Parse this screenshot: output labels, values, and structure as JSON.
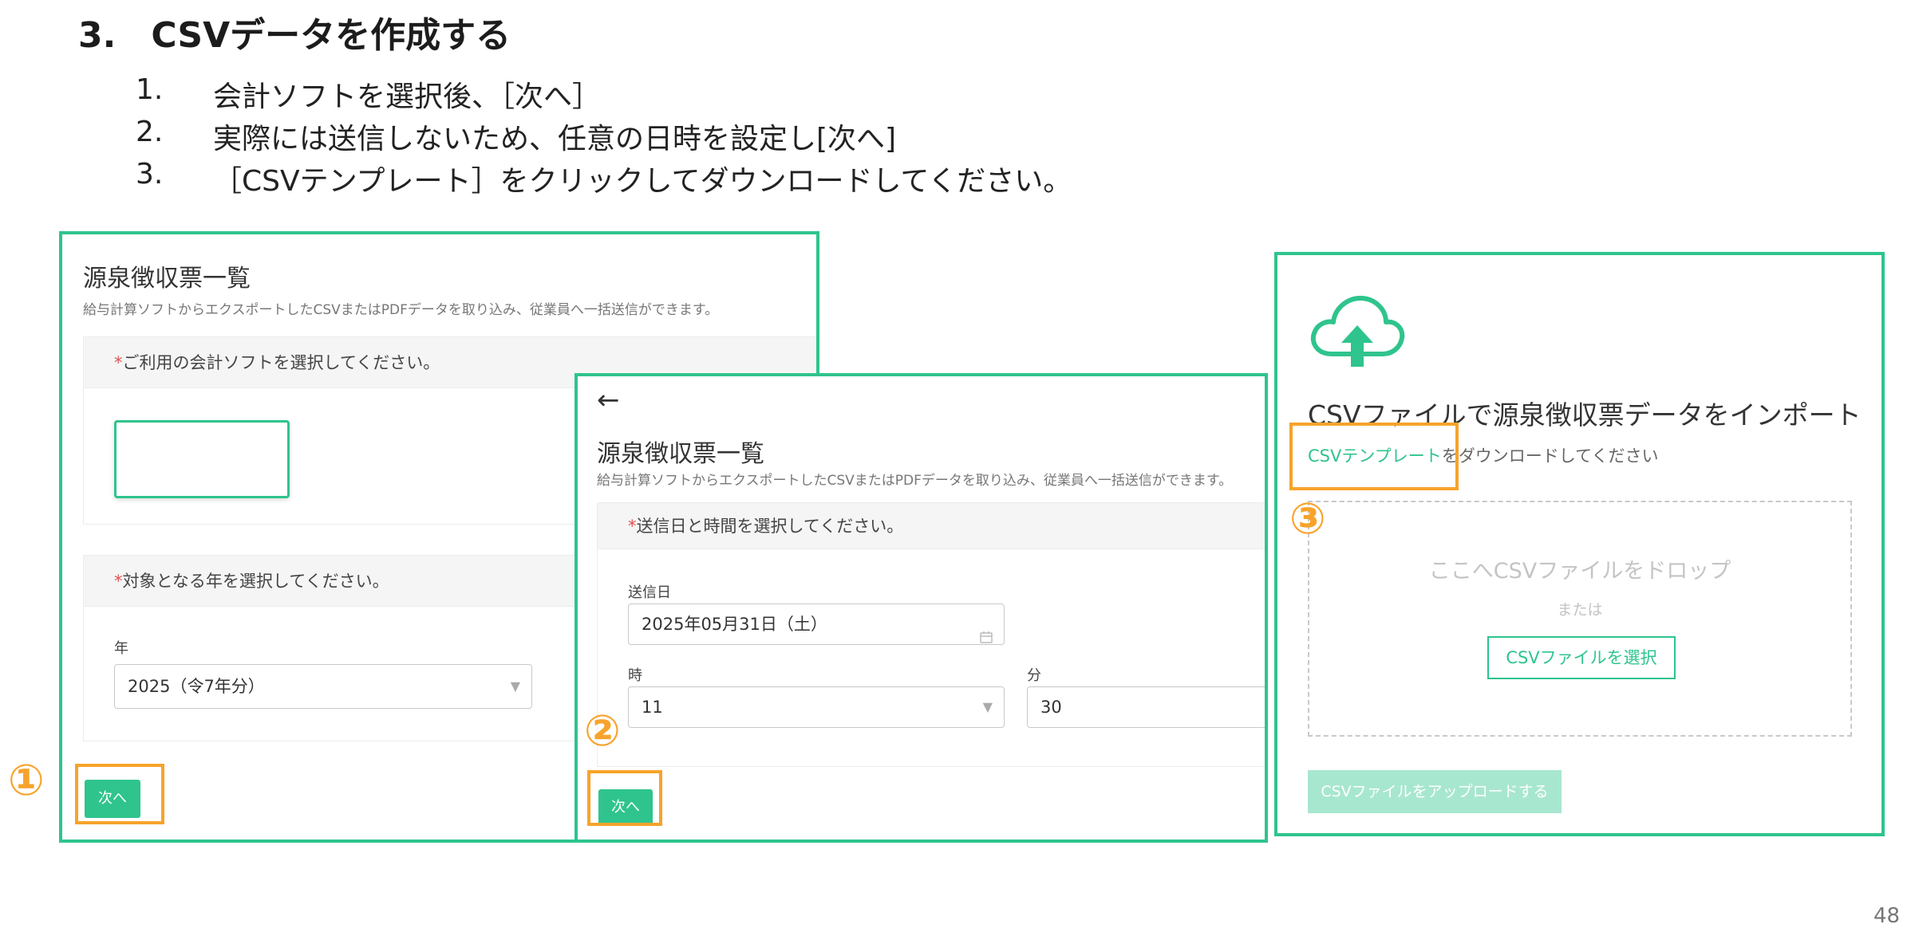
{
  "heading": "3.　CSVデータを作成する",
  "steps": [
    {
      "num": "1.",
      "text": "会計ソフトを選択後、［次へ］"
    },
    {
      "num": "2.",
      "text": "実際には送信しないため、任意の日時を設定し[次へ]"
    },
    {
      "num": "3.",
      "text": "［CSVテンプレート］をクリックしてダウンロードしてください。"
    }
  ],
  "panel1": {
    "title": "源泉徴収票一覧",
    "description": "給与計算ソフトからエクスポートしたCSVまたはPDFデータを取り込み、従業員へ一括送信ができます。",
    "software_section_label": "ご利用の会計ソフトを選択してください。",
    "year_section_label": "対象となる年を選択してください。",
    "year_label": "年",
    "year_value": "2025（令7年分）",
    "next_label": "次へ",
    "required_mark": "*"
  },
  "panel2": {
    "back_arrow": "←",
    "title": "源泉徴収票一覧",
    "description": "給与計算ソフトからエクスポートしたCSVまたはPDFデータを取り込み、従業員へ一括送信ができます。",
    "section_label": "送信日と時間を選択してください。",
    "date_label": "送信日",
    "date_value": "2025年05月31日（土）",
    "hour_label": "時",
    "hour_value": "11",
    "minute_label": "分",
    "minute_value": "30",
    "next_label": "次へ",
    "required_mark": "*"
  },
  "panel3": {
    "title": "CSVファイルで源泉徴収票データをインポート",
    "template_link": "CSVテンプレート",
    "template_suffix": "をダウンロードしてください",
    "drop_text": "ここへCSVファイルをドロップ",
    "or_text": "または",
    "select_button": "CSVファイルを選択",
    "upload_button": "CSVファイルをアップロードする"
  },
  "markers": [
    "①",
    "②",
    "③"
  ],
  "page_number": "48",
  "colors": {
    "accent": "#2fc48d",
    "highlight": "#f7a32b",
    "required": "#e05050"
  },
  "icons": {
    "upload": "cloud-upload-icon",
    "calendar": "calendar-icon",
    "dropdown": "chevron-down-icon",
    "back": "arrow-left-icon"
  }
}
